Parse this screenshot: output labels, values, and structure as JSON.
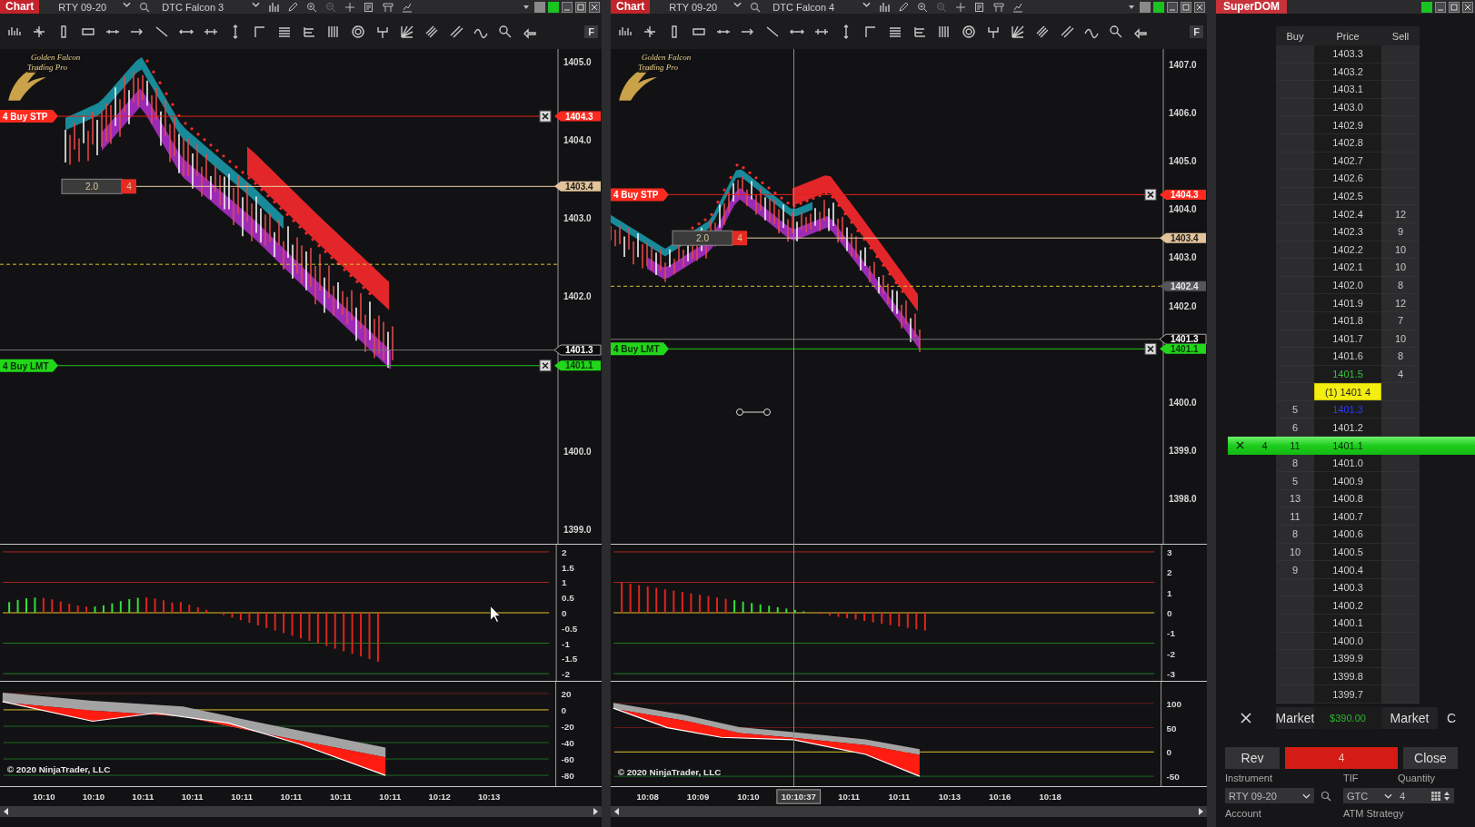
{
  "charts": [
    {
      "title": "Chart",
      "instrument": "RTY 09-20",
      "template": "DTC Falcon 3",
      "f_button": "F",
      "logo": "Golden Falcon Trading Pro",
      "price_axis": [
        "1405.0",
        "1404.0",
        "1403.0",
        "1402.0",
        "1400.0",
        "1399.0"
      ],
      "markers": [
        {
          "text": "1404.3",
          "kind": "stop"
        },
        {
          "text": "1403.4",
          "kind": "target"
        },
        {
          "text": "1401.3",
          "kind": "last"
        },
        {
          "text": "1401.1",
          "kind": "limit"
        }
      ],
      "orders": [
        {
          "label": "4 Buy STP",
          "kind": "stop"
        },
        {
          "label": "4 Buy LMT",
          "kind": "limit"
        }
      ],
      "position": {
        "price": "2.0",
        "qty": "4"
      },
      "osc_axis": [
        "2",
        "1.5",
        "1",
        "0.5",
        "0",
        "-0.5",
        "-1",
        "-1.5",
        "-2"
      ],
      "macd_axis": [
        "20",
        "0",
        "-20",
        "-40",
        "-60",
        "-80"
      ],
      "copyright": "© 2020 NinjaTrader, LLC",
      "time_axis": [
        {
          "label": "10:10",
          "selected": false
        },
        {
          "label": "10:10",
          "selected": false
        },
        {
          "label": "10:11",
          "selected": false
        },
        {
          "label": "10:11",
          "selected": false
        },
        {
          "label": "10:11",
          "selected": false
        },
        {
          "label": "10:11",
          "selected": false
        },
        {
          "label": "10:11",
          "selected": false
        },
        {
          "label": "10:11",
          "selected": false
        },
        {
          "label": "10:12",
          "selected": false
        },
        {
          "label": "10:13",
          "selected": false
        }
      ]
    },
    {
      "title": "Chart",
      "instrument": "RTY 09-20",
      "template": "DTC Falcon 4",
      "f_button": "F",
      "logo": "Golden Falcon Trading Pro",
      "price_axis": [
        "1407.0",
        "1406.0",
        "1405.0",
        "1404.0",
        "1403.0",
        "1402.0",
        "1400.0",
        "1399.0",
        "1398.0"
      ],
      "markers": [
        {
          "text": "1404.3",
          "kind": "stop"
        },
        {
          "text": "1403.4",
          "kind": "target"
        },
        {
          "text": "1402.4",
          "kind": "avg"
        },
        {
          "text": "1401.3",
          "kind": "last"
        },
        {
          "text": "1401.1",
          "kind": "limit"
        }
      ],
      "orders": [
        {
          "label": "4 Buy STP",
          "kind": "stop"
        },
        {
          "label": "4 Buy LMT",
          "kind": "limit"
        }
      ],
      "position": {
        "price": "2.0",
        "qty": "4"
      },
      "osc_axis": [
        "3",
        "2",
        "1",
        "0",
        "-1",
        "-2",
        "-3"
      ],
      "macd_axis": [
        "100",
        "50",
        "0",
        "-50"
      ],
      "copyright": "© 2020 NinjaTrader, LLC",
      "time_axis": [
        {
          "label": "10:08",
          "selected": false
        },
        {
          "label": "10:09",
          "selected": false
        },
        {
          "label": "10:10",
          "selected": false
        },
        {
          "label": "10:10:37",
          "selected": true
        },
        {
          "label": "10:11",
          "selected": false
        },
        {
          "label": "10:11",
          "selected": false
        },
        {
          "label": "10:13",
          "selected": false
        },
        {
          "label": "10:16",
          "selected": false
        },
        {
          "label": "10:18",
          "selected": false
        }
      ]
    }
  ],
  "superdom": {
    "title": "SuperDOM",
    "columns": [
      "Buy",
      "Price",
      "Sell"
    ],
    "rows": [
      {
        "kind": "normal",
        "price": "1403.3"
      },
      {
        "kind": "normal",
        "price": "1403.2"
      },
      {
        "kind": "normal",
        "price": "1403.1"
      },
      {
        "kind": "normal",
        "price": "1403.0"
      },
      {
        "kind": "normal",
        "price": "1402.9"
      },
      {
        "kind": "normal",
        "price": "1402.8"
      },
      {
        "kind": "normal",
        "price": "1402.7"
      },
      {
        "kind": "normal",
        "price": "1402.6"
      },
      {
        "kind": "normal",
        "price": "1402.5"
      },
      {
        "kind": "normal",
        "price": "1402.4",
        "sell": "12"
      },
      {
        "kind": "normal",
        "price": "1402.3",
        "sell": "9"
      },
      {
        "kind": "normal",
        "price": "1402.2",
        "sell": "10"
      },
      {
        "kind": "normal",
        "price": "1402.1",
        "sell": "10"
      },
      {
        "kind": "normal",
        "price": "1402.0",
        "sell": "8"
      },
      {
        "kind": "normal",
        "price": "1401.9",
        "sell": "12"
      },
      {
        "kind": "normal",
        "price": "1401.8",
        "sell": "7"
      },
      {
        "kind": "normal",
        "price": "1401.7",
        "sell": "10"
      },
      {
        "kind": "normal",
        "price": "1401.6",
        "sell": "8"
      },
      {
        "kind": "last",
        "price": "1401.5",
        "sell": "4"
      },
      {
        "kind": "ask",
        "price": "(1) 1401 4"
      },
      {
        "kind": "bid",
        "buy": "5",
        "price": "1401.3"
      },
      {
        "kind": "normal",
        "buy": "6",
        "price": "1401.2"
      },
      {
        "kind": "order",
        "order_qty": "4",
        "buy": "11",
        "price": "1401.1"
      },
      {
        "kind": "normal",
        "buy": "8",
        "price": "1401.0"
      },
      {
        "kind": "normal",
        "buy": "5",
        "price": "1400.9"
      },
      {
        "kind": "normal",
        "buy": "13",
        "price": "1400.8"
      },
      {
        "kind": "normal",
        "buy": "11",
        "price": "1400.7"
      },
      {
        "kind": "normal",
        "buy": "8",
        "price": "1400.6"
      },
      {
        "kind": "normal",
        "buy": "10",
        "price": "1400.5"
      },
      {
        "kind": "normal",
        "buy": "9",
        "price": "1400.4"
      },
      {
        "kind": "normal",
        "price": "1400.3"
      },
      {
        "kind": "normal",
        "price": "1400.2"
      },
      {
        "kind": "normal",
        "price": "1400.1"
      },
      {
        "kind": "normal",
        "price": "1400.0"
      },
      {
        "kind": "normal",
        "price": "1399.9"
      },
      {
        "kind": "normal",
        "price": "1399.8"
      },
      {
        "kind": "normal",
        "price": "1399.7"
      }
    ],
    "buy_market": "Market",
    "pnl": "$390.00",
    "sell_market": "Market",
    "close_short": "C",
    "rev_button": "Rev",
    "position_qty": "4",
    "close_button": "Close",
    "instrument_label": "Instrument",
    "instrument": "RTY 09-20",
    "tif_label": "TIF",
    "tif": "GTC",
    "quantity_label": "Quantity",
    "quantity": "4",
    "account_label": "Account",
    "atm_label": "ATM Strategy"
  }
}
